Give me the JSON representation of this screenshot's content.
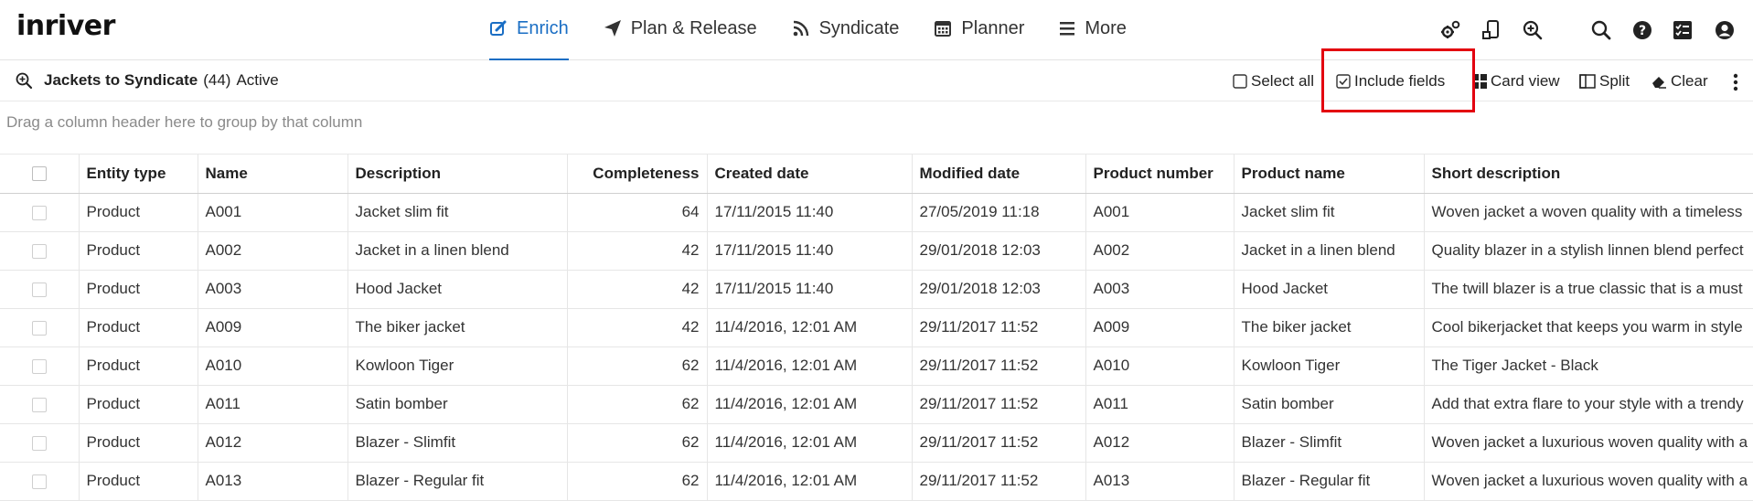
{
  "app": {
    "logo": "inriver"
  },
  "nav": {
    "items": [
      {
        "label": "Enrich",
        "icon": "edit-icon",
        "active": true
      },
      {
        "label": "Plan & Release",
        "icon": "paper-plane-icon",
        "active": false
      },
      {
        "label": "Syndicate",
        "icon": "rss-icon",
        "active": false
      },
      {
        "label": "Planner",
        "icon": "calendar-icon",
        "active": false
      },
      {
        "label": "More",
        "icon": "hamburger-icon",
        "active": false
      }
    ],
    "accent": "#1a6ec4"
  },
  "top_icons": [
    "gears-icon",
    "mobile-icon",
    "zoom-in-icon",
    "search-icon",
    "help-icon",
    "tasks-icon",
    "user-icon"
  ],
  "query": {
    "name": "Jackets to Syndicate",
    "count": "(44)",
    "state": "Active"
  },
  "toolbar": {
    "select_all": "Select all",
    "include_fields": "Include fields",
    "card_view": "Card view",
    "split": "Split",
    "clear": "Clear"
  },
  "highlight_color": "#e3000f",
  "group_hint": "Drag a column header here to group by that column",
  "grid": {
    "columns": [
      "Entity type",
      "Name",
      "Description",
      "Completeness",
      "Created date",
      "Modified date",
      "Product number",
      "Product name",
      "Short description"
    ],
    "rows": [
      [
        "Product",
        "A001",
        "Jacket slim fit",
        "64",
        "17/11/2015 11:40",
        "27/05/2019 11:18",
        "A001",
        "Jacket slim fit",
        "Woven jacket a woven quality with a timeless"
      ],
      [
        "Product",
        "A002",
        "Jacket in a linen blend",
        "42",
        "17/11/2015 11:40",
        "29/01/2018 12:03",
        "A002",
        "Jacket in a linen blend",
        "Quality blazer in a stylish linnen blend perfect"
      ],
      [
        "Product",
        "A003",
        "Hood Jacket",
        "42",
        "17/11/2015 11:40",
        "29/01/2018 12:03",
        "A003",
        "Hood Jacket",
        "The twill blazer is a true classic that is a must"
      ],
      [
        "Product",
        "A009",
        "The biker jacket",
        "42",
        "11/4/2016, 12:01 AM",
        "29/11/2017 11:52",
        "A009",
        "The biker jacket",
        "Cool bikerjacket that keeps you warm in style"
      ],
      [
        "Product",
        "A010",
        "Kowloon Tiger",
        "62",
        "11/4/2016, 12:01 AM",
        "29/11/2017 11:52",
        "A010",
        "Kowloon Tiger",
        "The Tiger Jacket - Black"
      ],
      [
        "Product",
        "A011",
        "Satin bomber",
        "62",
        "11/4/2016, 12:01 AM",
        "29/11/2017 11:52",
        "A011",
        "Satin bomber",
        "Add that extra flare to your style with a trendy"
      ],
      [
        "Product",
        "A012",
        "Blazer - Slimfit",
        "62",
        "11/4/2016, 12:01 AM",
        "29/11/2017 11:52",
        "A012",
        "Blazer - Slimfit",
        "Woven jacket a luxurious woven quality with a"
      ],
      [
        "Product",
        "A013",
        "Blazer - Regular fit",
        "62",
        "11/4/2016, 12:01 AM",
        "29/11/2017 11:52",
        "A013",
        "Blazer - Regular fit",
        "Woven jacket a luxurious woven quality with a"
      ]
    ]
  }
}
